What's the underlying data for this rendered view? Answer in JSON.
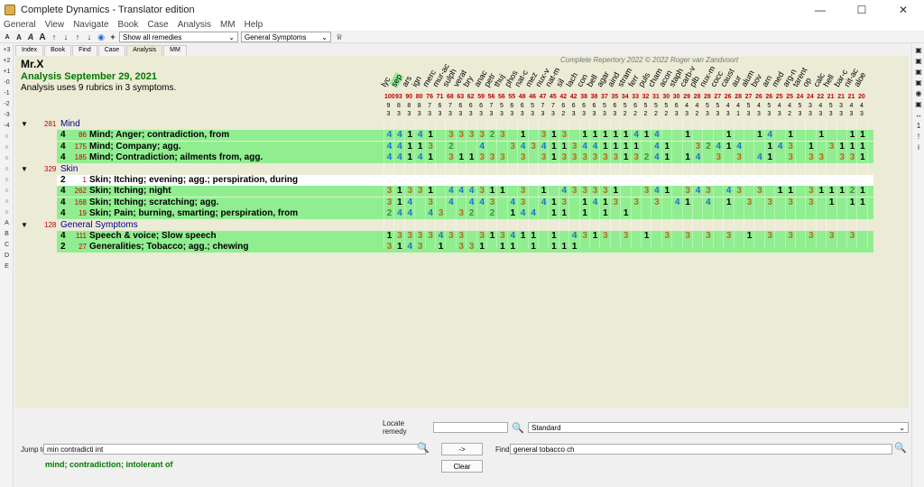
{
  "window": {
    "title": "Complete Dynamics - Translator edition",
    "controls": [
      "—",
      "☐",
      "✕"
    ]
  },
  "menu": [
    "General",
    "View",
    "Navigate",
    "Book",
    "Case",
    "Analysis",
    "MM",
    "Help"
  ],
  "toolbar": {
    "buttons": [
      "A",
      "A",
      "A",
      "A",
      "↑",
      "↓",
      "↑",
      "↓",
      "◉",
      "+"
    ],
    "remedy_filter": "Show all remedies",
    "symptom_filter": "General Symptoms"
  },
  "left_strip": [
    "+3",
    "+2",
    "+1",
    "-0",
    "-1",
    "-2",
    "-3",
    "-4",
    "○",
    "○",
    "○",
    "○",
    "○",
    "○",
    "○",
    "○",
    "A",
    "B",
    "C",
    "D",
    "E"
  ],
  "right_strip": [
    "▣",
    "▣",
    "▣",
    "▣",
    "◉",
    "▣",
    "↔",
    "1",
    "!",
    "i"
  ],
  "tabs": [
    "Index",
    "Book",
    "Find",
    "Case",
    "Analysis",
    "MM"
  ],
  "copyright": "Complete Repertory 2022 © 2022 Roger van Zandvoort",
  "patient": "Mr.X",
  "analysis_title": "Analysis September 29, 2021",
  "analysis_sub": "Analysis uses 9 rubrics in 3 symptoms.",
  "remedies": [
    {
      "abbr": "lyc",
      "score": 100,
      "rubrics": 9,
      "symptoms": 3
    },
    {
      "abbr": "sep",
      "score": 93,
      "rubrics": 8,
      "symptoms": 3
    },
    {
      "abbr": "ars",
      "score": 90,
      "rubrics": 8,
      "symptoms": 3
    },
    {
      "abbr": "ign",
      "score": 80,
      "rubrics": 8,
      "symptoms": 3
    },
    {
      "abbr": "merc",
      "score": 76,
      "rubrics": 7,
      "symptoms": 3
    },
    {
      "abbr": "mur-ac",
      "score": 71,
      "rubrics": 6,
      "symptoms": 3
    },
    {
      "abbr": "sulph",
      "score": 68,
      "rubrics": 7,
      "symptoms": 3
    },
    {
      "abbr": "verat",
      "score": 63,
      "rubrics": 6,
      "symptoms": 3
    },
    {
      "abbr": "bry",
      "score": 62,
      "rubrics": 6,
      "symptoms": 3
    },
    {
      "abbr": "anac",
      "score": 59,
      "rubrics": 6,
      "symptoms": 3
    },
    {
      "abbr": "petr",
      "score": 56,
      "rubrics": 7,
      "symptoms": 3
    },
    {
      "abbr": "thuj",
      "score": 56,
      "rubrics": 5,
      "symptoms": 3
    },
    {
      "abbr": "phos",
      "score": 55,
      "rubrics": 6,
      "symptoms": 3
    },
    {
      "abbr": "nat-c",
      "score": 48,
      "rubrics": 6,
      "symptoms": 3
    },
    {
      "abbr": "mez",
      "score": 46,
      "rubrics": 5,
      "symptoms": 3
    },
    {
      "abbr": "nux-v",
      "score": 47,
      "rubrics": 7,
      "symptoms": 3
    },
    {
      "abbr": "nat-m",
      "score": 45,
      "rubrics": 7,
      "symptoms": 3
    },
    {
      "abbr": "sil",
      "score": 42,
      "rubrics": 6,
      "symptoms": 2
    },
    {
      "abbr": "lach",
      "score": 42,
      "rubrics": 6,
      "symptoms": 3
    },
    {
      "abbr": "con",
      "score": 38,
      "rubrics": 6,
      "symptoms": 3
    },
    {
      "abbr": "bell",
      "score": 38,
      "rubrics": 6,
      "symptoms": 3
    },
    {
      "abbr": "agar",
      "score": 37,
      "rubrics": 5,
      "symptoms": 3
    },
    {
      "abbr": "aind",
      "score": 35,
      "rubrics": 6,
      "symptoms": 3
    },
    {
      "abbr": "stram",
      "score": 34,
      "rubrics": 5,
      "symptoms": 2
    },
    {
      "abbr": "ferr",
      "score": 33,
      "rubrics": 6,
      "symptoms": 2
    },
    {
      "abbr": "puls",
      "score": 32,
      "rubrics": 5,
      "symptoms": 2
    },
    {
      "abbr": "cham",
      "score": 31,
      "rubrics": 5,
      "symptoms": 2
    },
    {
      "abbr": "acon",
      "score": 30,
      "rubrics": 5,
      "symptoms": 2
    },
    {
      "abbr": "staph",
      "score": 30,
      "rubrics": 6,
      "symptoms": 3
    },
    {
      "abbr": "carb-v",
      "score": 29,
      "rubrics": 4,
      "symptoms": 3
    },
    {
      "abbr": "plb",
      "score": 28,
      "rubrics": 4,
      "symptoms": 2
    },
    {
      "abbr": "nux-m",
      "score": 28,
      "rubrics": 5,
      "symptoms": 3
    },
    {
      "abbr": "cocc",
      "score": 27,
      "rubrics": 5,
      "symptoms": 3
    },
    {
      "abbr": "caust",
      "score": 26,
      "rubrics": 4,
      "symptoms": 3
    },
    {
      "abbr": "aur",
      "score": 28,
      "rubrics": 4,
      "symptoms": 1
    },
    {
      "abbr": "alum",
      "score": 27,
      "rubrics": 5,
      "symptoms": 3
    },
    {
      "abbr": "bov",
      "score": 26,
      "rubrics": 4,
      "symptoms": 3
    },
    {
      "abbr": "arn",
      "score": 26,
      "rubrics": 5,
      "symptoms": 3
    },
    {
      "abbr": "med",
      "score": 25,
      "rubrics": 4,
      "symptoms": 3
    },
    {
      "abbr": "arg-n",
      "score": 25,
      "rubrics": 4,
      "symptoms": 2
    },
    {
      "abbr": "tarent",
      "score": 24,
      "rubrics": 5,
      "symptoms": 3
    },
    {
      "abbr": "op",
      "score": 24,
      "rubrics": 3,
      "symptoms": 3
    },
    {
      "abbr": "calc",
      "score": 22,
      "rubrics": 4,
      "symptoms": 3
    },
    {
      "abbr": "hell",
      "score": 21,
      "rubrics": 5,
      "symptoms": 3
    },
    {
      "abbr": "bar-c",
      "score": 21,
      "rubrics": 3,
      "symptoms": 3
    },
    {
      "abbr": "nit-ac",
      "score": 21,
      "rubrics": 4,
      "symptoms": 3
    },
    {
      "abbr": "aloe",
      "score": 20,
      "rubrics": 4,
      "symptoms": 3
    }
  ],
  "rows": [
    {
      "type": "group",
      "count": 281,
      "name": "Mind"
    },
    {
      "type": "rubric",
      "grade": 4,
      "count": 86,
      "text": "Mind; Anger; contradiction, from",
      "cells": "44141 333323 1 313 11111414  1   1  14 1  1  11",
      "style": "green"
    },
    {
      "type": "rubric",
      "grade": 4,
      "count": 175,
      "text": "Mind; Company; agg.",
      "cells": "44113 2  4  3434113441111 41  32414  143 1 3111141 1",
      "style": "green"
    },
    {
      "type": "rubric",
      "grade": 4,
      "count": 185,
      "text": "Mind; Contradiction; ailments from, agg.",
      "cells": "44141 311333 3 3133333313241 14 3 3 41 3 33 331",
      "style": "green"
    },
    {
      "type": "group",
      "count": 329,
      "name": "Skin"
    },
    {
      "type": "rubric",
      "grade": 2,
      "count": 1,
      "text": "Skin; Itching; evening; agg.; perspiration, during",
      "cells": " ",
      "style": "white"
    },
    {
      "type": "rubric",
      "grade": 4,
      "count": 262,
      "text": "Skin; Itching; night",
      "cells": "31331 444311 3 1 433331  341 343 43 3 11 3111213 331",
      "style": "green"
    },
    {
      "type": "rubric",
      "grade": 4,
      "count": 168,
      "text": "Skin; Itching; scratching; agg.",
      "cells": "314 3 4 443 43 413 1413 3 3 41 4 1 3 3 3 3 1 11",
      "style": "green"
    },
    {
      "type": "rubric",
      "grade": 4,
      "count": 19,
      "text": "Skin; Pain; burning, smarting; perspiration, from",
      "cells": "244 43 32 2 144 11 1 1 1",
      "style": "green"
    },
    {
      "type": "group",
      "count": 128,
      "name": "General Symptoms"
    },
    {
      "type": "rubric",
      "grade": 4,
      "count": 111,
      "text": "Speech & voice; Slow speech",
      "cells": "13333433 313411 1 4313 3 1 3 3 3 3 1 3 3 3 3 3 1 3 41",
      "style": "green"
    },
    {
      "type": "rubric",
      "grade": 2,
      "count": 27,
      "text": "Generalities; Tobacco; agg.; chewing",
      "cells": "3143 1 331 11 1 111",
      "style": "green"
    }
  ],
  "locate": {
    "label": "Locate remedy",
    "value": "",
    "mode": "Standard"
  },
  "bottom": {
    "jump_label": "Jump to",
    "jump_value": "min contradicti int",
    "arrow_btn": "->",
    "clear_btn": "Clear",
    "find_label": "Find",
    "find_value": "general tobacco ch",
    "suggestion": "mind; contradiction; intolerant of"
  },
  "colors": {
    "row_green": "#90ee90",
    "panel_bg": "#ecebd6",
    "group_title": "#00008b",
    "analysis_green": "#007a00"
  }
}
